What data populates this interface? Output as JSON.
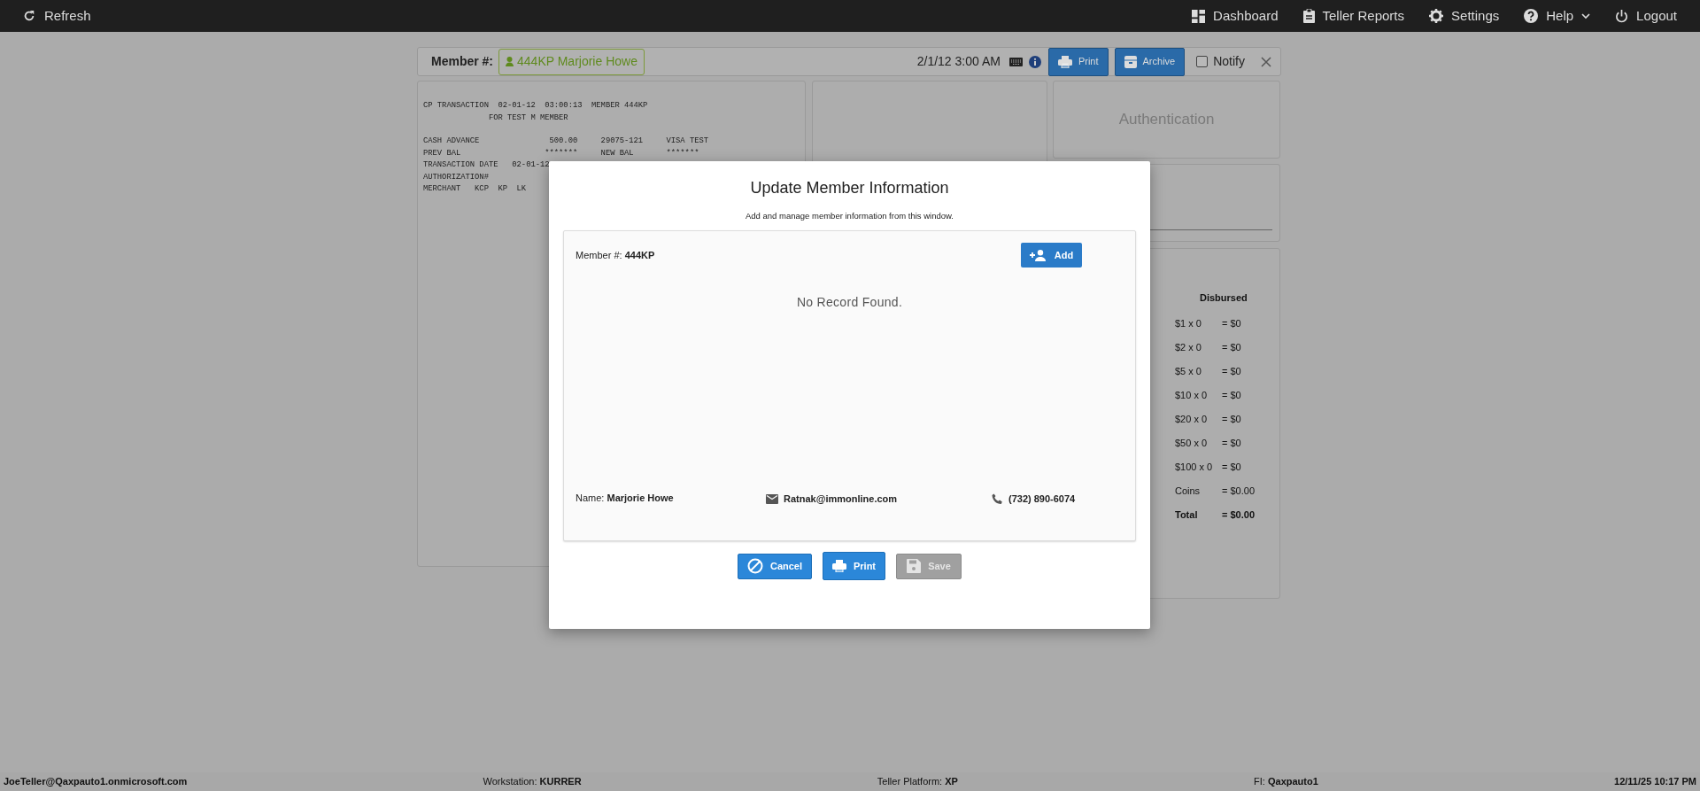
{
  "top_bar": {
    "refresh": "Refresh",
    "nav": [
      {
        "label": "Dashboard",
        "kind": "dashboard",
        "has_menu": false
      },
      {
        "label": "Teller Reports",
        "kind": "reports",
        "has_menu": false
      },
      {
        "label": "Settings",
        "kind": "settings",
        "has_menu": false
      },
      {
        "label": "Help",
        "kind": "help",
        "has_menu": true
      },
      {
        "label": "Logout",
        "kind": "logout",
        "has_menu": false
      }
    ]
  },
  "member_bar": {
    "label": "Member #:",
    "member_chip": "444KP Marjorie Howe",
    "datetime": "2/1/12 3:00 AM",
    "buttons": [
      {
        "label": "Print",
        "kind": "print"
      },
      {
        "label": "Archive",
        "kind": "archive"
      }
    ],
    "notify": {
      "label": "Notify",
      "checked": false
    }
  },
  "receipt": {
    "blocks": [
      [
        "CP TRANSACTION  02-01-12  03:00:13  MEMBER 444KP",
        "              FOR TEST M MEMBER"
      ],
      [
        "CASH ADVANCE               500.00     29075-121     VISA TEST",
        "PREV BAL                  *******     NEW BAL       *******",
        "TRANSACTION DATE   02-01-12",
        "AUTHORIZATION#",
        "MERCHANT   KCP  KP  LK"
      ]
    ]
  },
  "authentication_panel": {
    "title": "Authentication"
  },
  "disbursed": {
    "title": "Disbursed",
    "rows": [
      {
        "label": "$1 x 0",
        "value": "= $0",
        "kind": "denomination"
      },
      {
        "label": "$2 x 0",
        "value": "= $0",
        "kind": "denomination"
      },
      {
        "label": "$5 x 0",
        "value": "= $0",
        "kind": "denomination"
      },
      {
        "label": "$10 x 0",
        "value": "= $0",
        "kind": "denomination"
      },
      {
        "label": "$20 x 0",
        "value": "= $0",
        "kind": "denomination"
      },
      {
        "label": "$50 x 0",
        "value": "= $0",
        "kind": "denomination"
      },
      {
        "label": "$100 x 0",
        "value": "= $0",
        "kind": "denomination"
      },
      {
        "label": "Coins",
        "value": "= $0.00",
        "kind": "denomination"
      },
      {
        "label": "Total",
        "value": "= $0.00",
        "kind": "total"
      }
    ]
  },
  "modal": {
    "title": "Update Member Information",
    "subtitle": "Add and manage member information from this window.",
    "member_label": "Member #:",
    "member_number": "444KP",
    "add_button": "Add",
    "empty_message": "No Record Found.",
    "name_label": "Name:",
    "name": "Marjorie Howe",
    "email": "Ratnak@immonline.com",
    "phone": "(732) 890-6074",
    "buttons": [
      {
        "label": "Cancel",
        "kind": "cancel",
        "disabled": false
      },
      {
        "label": "Print",
        "kind": "print",
        "disabled": false
      },
      {
        "label": "Save",
        "kind": "save",
        "disabled": true
      }
    ]
  },
  "status_bar": {
    "fields": [
      {
        "value": "JoeTeller@Qaxpauto1.onmicrosoft.com"
      },
      {
        "label": "Workstation:",
        "value": "KURRER"
      },
      {
        "label": "Teller Platform:",
        "value": "XP"
      },
      {
        "label": "FI:",
        "value": "Qaxpauto1"
      },
      {
        "value": "12/11/25 10:17 PM"
      }
    ]
  }
}
